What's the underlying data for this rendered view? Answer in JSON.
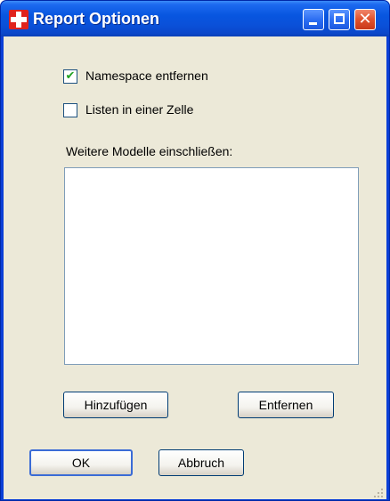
{
  "window": {
    "title": "Report Optionen",
    "app_icon": "red-cross-icon",
    "controls": {
      "minimize": "minimize-icon",
      "maximize": "maximize-icon",
      "close": "close-icon"
    }
  },
  "options": {
    "namespace": {
      "label": "Namespace entfernen",
      "checked": true
    },
    "lists": {
      "label": "Listen in einer Zelle",
      "checked": false
    }
  },
  "models": {
    "label": "Weitere Modelle einschließen:",
    "items": []
  },
  "buttons": {
    "add": "Hinzufügen",
    "remove": "Entfernen",
    "ok": "OK",
    "cancel": "Abbruch"
  },
  "colors": {
    "titlebar": "#0a50d8",
    "client_bg": "#ece9d8",
    "checkmark": "#21a121",
    "close_button": "#e0512c"
  }
}
